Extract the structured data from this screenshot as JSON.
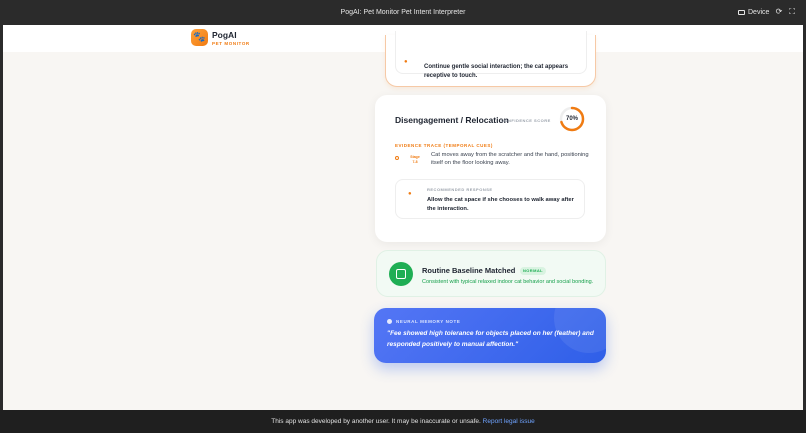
{
  "window": {
    "title": "PogAI: Pet Monitor Pet Intent Interpreter",
    "device_label": "Device"
  },
  "header": {
    "app_name": "PogAI",
    "app_sub": "PET MONITOR"
  },
  "top_card": {
    "recommendation": "Continue gentle social interaction; the cat appears receptive to touch."
  },
  "main_card": {
    "title": "Disengagement / Relocation",
    "score_label": "CONFIDENCE SCORE",
    "score": "70%",
    "score_fraction": 0.7,
    "evidence_label": "EVIDENCE TRACE (TEMPORAL CUES)",
    "stage_line1": "Stage",
    "stage_line2": "7-8",
    "evidence_text": "Cat moves away from the scratcher and the hand, positioning itself on the floor looking away.",
    "rec_label": "RECOMMENDED RESPONSE",
    "rec_text": "Allow the cat space if she chooses to walk away after the interaction."
  },
  "baseline": {
    "title": "Routine Baseline Matched",
    "badge": "NORMAL",
    "description": "Consistent with typical relaxed indoor cat behavior and social bonding."
  },
  "memory": {
    "label": "NEURAL MEMORY NOTE",
    "quote": "\"Fee showed high tolerance for objects placed on her (feather) and responded positively to manual affection.\""
  },
  "footer": {
    "text": "This app was developed by another user. It may be inaccurate or unsafe.",
    "link": "Report legal issue"
  },
  "colors": {
    "accent": "#f07b12",
    "success": "#1fae54",
    "memory_blue": "#3a66ee"
  }
}
